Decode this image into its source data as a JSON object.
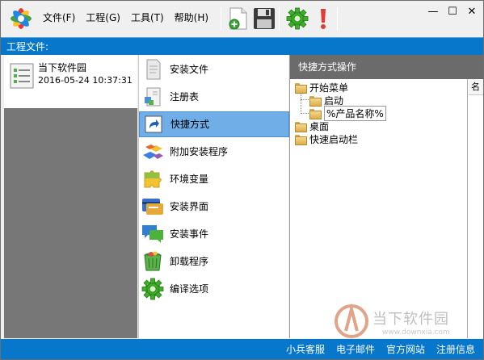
{
  "menu": {
    "items": [
      {
        "label": "文件(F)"
      },
      {
        "label": "工程(G)"
      },
      {
        "label": "工具(T)"
      },
      {
        "label": "帮助(H)"
      }
    ]
  },
  "toolbar": {
    "icons": [
      "new-file-icon",
      "save-icon",
      "gear-icon",
      "exclamation-icon"
    ]
  },
  "window_controls": {
    "minimize": "—",
    "maximize": "☐",
    "close": "✕"
  },
  "section": {
    "title": "工程文件:"
  },
  "project": {
    "name": "当下软件园",
    "date": "2016-05-24 10:37:31"
  },
  "categories": [
    {
      "label": "安装文件",
      "icon": "install-files-icon"
    },
    {
      "label": "注册表",
      "icon": "registry-icon"
    },
    {
      "label": "快捷方式",
      "icon": "shortcut-icon",
      "selected": true
    },
    {
      "label": "附加安装程序",
      "icon": "additional-installer-icon"
    },
    {
      "label": "环境变量",
      "icon": "puzzle-icon"
    },
    {
      "label": "安装界面",
      "icon": "install-ui-icon"
    },
    {
      "label": "安装事件",
      "icon": "chat-bubble-icon"
    },
    {
      "label": "卸载程序",
      "icon": "recycle-bin-icon"
    },
    {
      "label": "编译选项",
      "icon": "gear-icon"
    }
  ],
  "right_panel": {
    "title": "快捷方式操作",
    "column_header": "名",
    "tree": [
      {
        "label": "开始菜单",
        "level": 0
      },
      {
        "label": "启动",
        "level": 1
      },
      {
        "label": "%产品名称%",
        "level": 1,
        "editing": true
      },
      {
        "label": "桌面",
        "level": 0
      },
      {
        "label": "快速启动栏",
        "level": 0
      }
    ]
  },
  "status_bar": {
    "links": [
      "小兵客服",
      "电子邮件",
      "官方网站",
      "注册信息"
    ]
  },
  "watermark": {
    "text": "当下软件园",
    "url": "www.downxia.com"
  },
  "colors": {
    "accent": "#0777cc",
    "selected": "#70aee8",
    "header_gray": "#6b6b6b"
  }
}
